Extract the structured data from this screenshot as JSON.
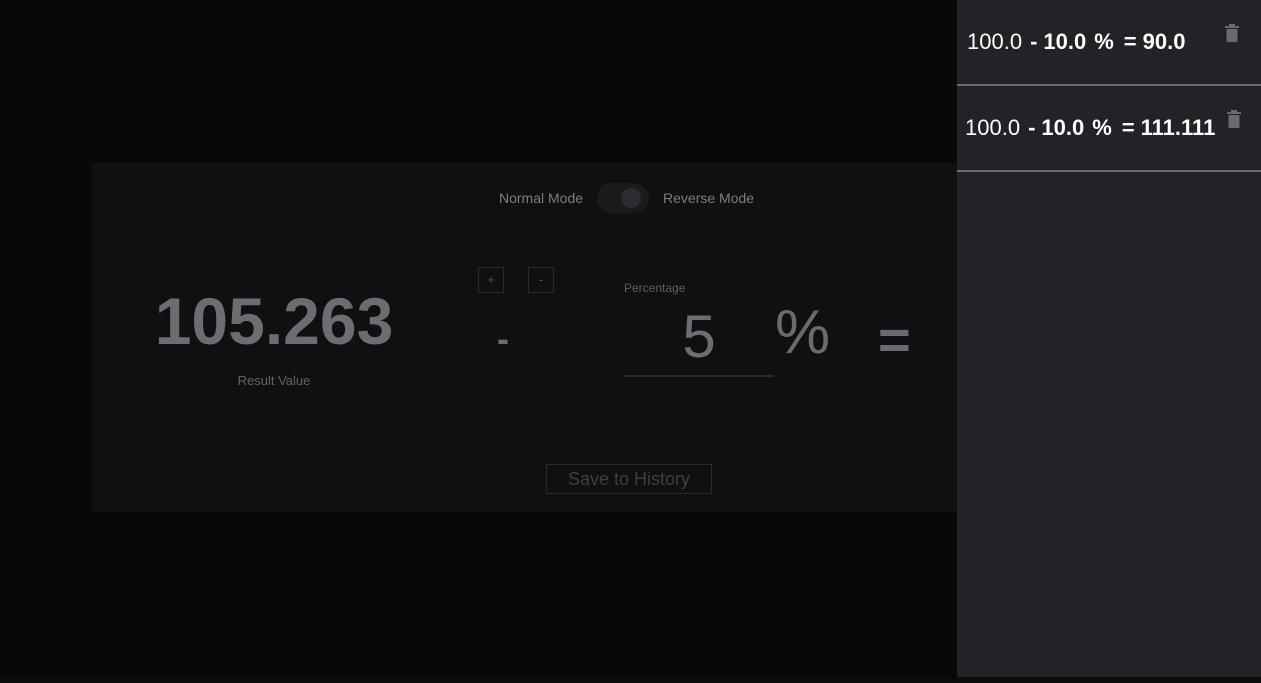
{
  "mode": {
    "normal_label": "Normal Mode",
    "reverse_label": "Reverse Mode"
  },
  "calculator": {
    "result_value": "105.263",
    "result_label": "Result Value",
    "plus_label": "+",
    "minus_label": "-",
    "operator": "-",
    "percentage_label": "Percentage",
    "percentage_value": "5",
    "percent_sign": "%",
    "equals": "=",
    "save_label": "Save to History"
  },
  "history": [
    {
      "base": "100.0",
      "op": "-",
      "pct": "10.0",
      "sign": "%",
      "eq": "=",
      "result": "90.0"
    },
    {
      "base": "100.0",
      "op": "-",
      "pct": "10.0",
      "sign": "%",
      "eq": "=",
      "result": "111.111"
    }
  ],
  "colors": {
    "background": "#080808",
    "panel": "#0f1012",
    "history_panel": "#222326",
    "history_text": "#ffffff"
  }
}
